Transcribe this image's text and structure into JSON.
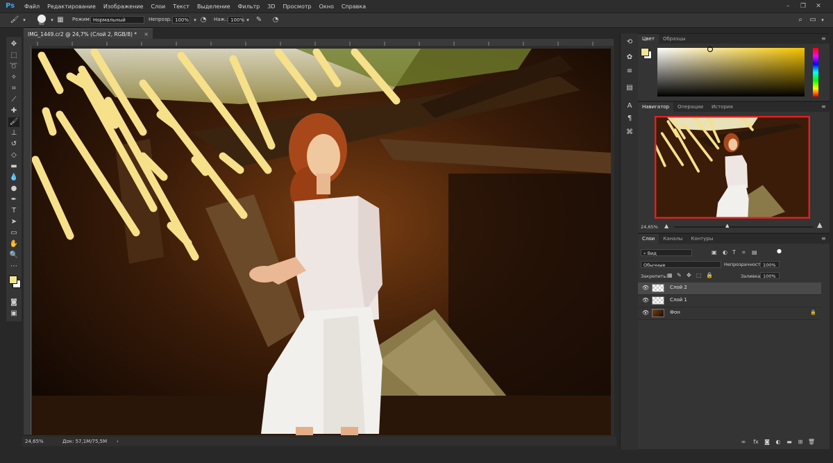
{
  "app": {
    "logo": "Ps"
  },
  "menu": [
    "Файл",
    "Редактирование",
    "Изображение",
    "Слои",
    "Текст",
    "Выделение",
    "Фильтр",
    "3D",
    "Просмотр",
    "Окно",
    "Справка"
  ],
  "options": {
    "brush_size": "60",
    "mode_label": "Режим:",
    "mode_value": "Нормальный",
    "opacity_label": "Непрозр.:",
    "opacity_value": "100%",
    "pressure_label": "Наж.:",
    "pressure_value": "100%"
  },
  "document": {
    "tab_title": "IMG_1449.cr2 @ 24,7% (Слой 2, RGB/8) *",
    "zoom": "24,65%",
    "doc_info": "Док: 57,1M/75,5M"
  },
  "color_panel": {
    "tabs": [
      "Цвет",
      "Образцы"
    ],
    "foreground": "#f3e491",
    "background": "#ffffff"
  },
  "navigator_panel": {
    "tabs": [
      "Навигатор",
      "Операции",
      "История"
    ],
    "zoom": "24,65%"
  },
  "layers_panel": {
    "tabs": [
      "Слои",
      "Каналы",
      "Контуры"
    ],
    "filter_label": "Вид",
    "blend_mode": "Обычные",
    "opacity_label": "Непрозрачность:",
    "opacity_value": "100%",
    "lock_label": "Закрепить:",
    "fill_label": "Заливка:",
    "fill_value": "100%",
    "layers": [
      {
        "name": "Слой 2",
        "selected": true
      },
      {
        "name": "Слой 1",
        "selected": false
      },
      {
        "name": "Фон",
        "selected": false,
        "locked": true
      }
    ]
  },
  "colors": {
    "stroke": "#f6e08a",
    "photo_dark": "#1a0d04",
    "photo_warm": "#8a4a18"
  }
}
